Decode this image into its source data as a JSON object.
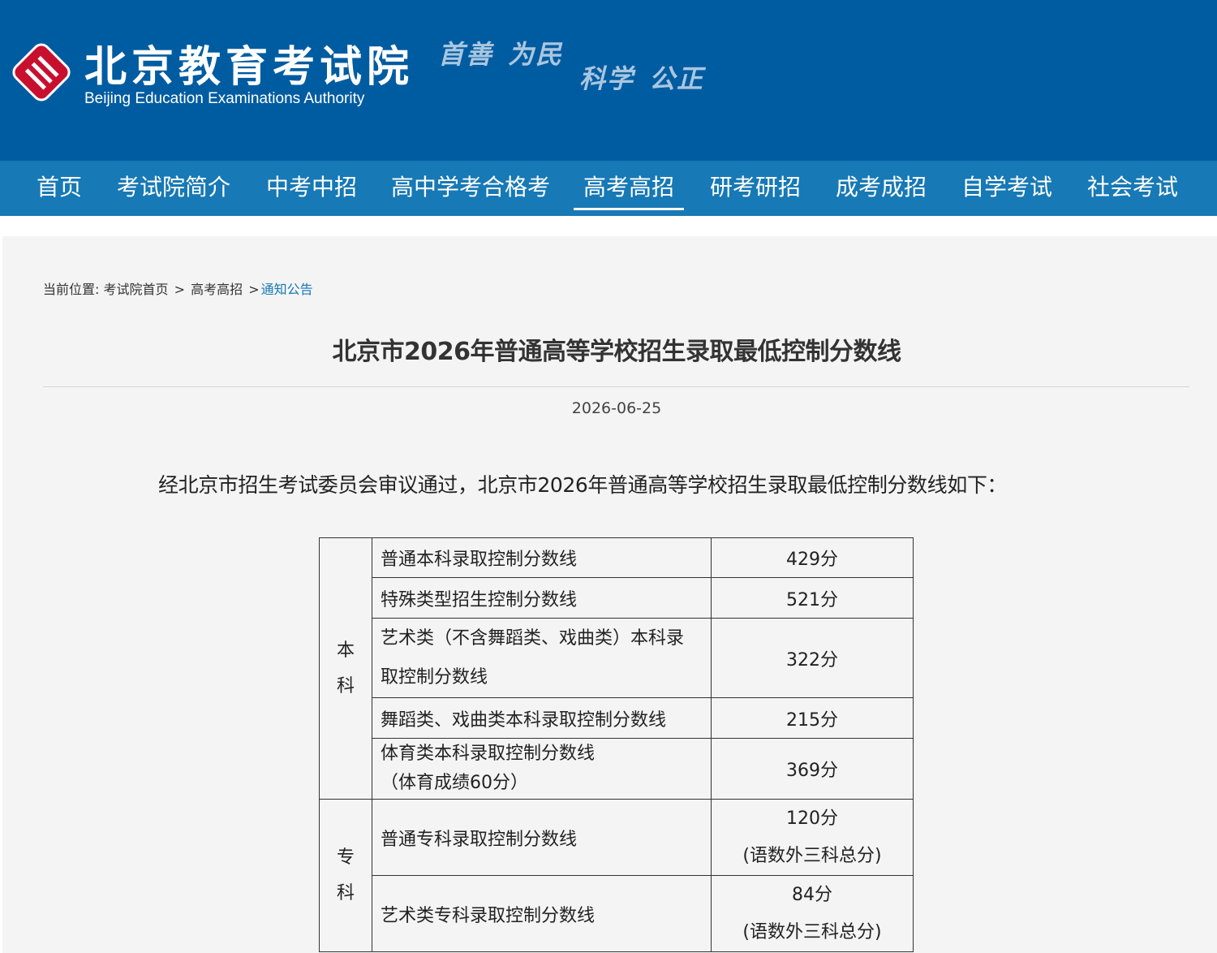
{
  "header": {
    "logo_cn": "北京教育考试院",
    "logo_en": "Beijing Education Examinations Authority",
    "motto": [
      "首善",
      "为民",
      "科学",
      "公正"
    ],
    "brand_color": "#005ca1",
    "emblem_color": "#c8102e"
  },
  "nav": {
    "items": [
      "首页",
      "考试院简介",
      "中考中招",
      "高中学考合格考",
      "高考高招",
      "研考研招",
      "成考成招",
      "自学考试",
      "社会考试"
    ],
    "active": "高考高招",
    "color": "#1779b5"
  },
  "breadcrumb": {
    "prefix": "当前位置:",
    "items": [
      "考试院首页",
      "高考高招",
      "通知公告"
    ],
    "separator": ">"
  },
  "article": {
    "title": "北京市2026年普通高等学校招生录取最低控制分数线",
    "date": "2026-06-25",
    "intro": "经北京市招生考试委员会审议通过，北京市2026年普通高等学校招生录取最低控制分数线如下："
  },
  "table": {
    "groups": [
      {
        "category": [
          "本",
          "科"
        ],
        "rows": [
          {
            "item": [
              "普通本科录取控制分数线"
            ],
            "value": [
              "429分"
            ]
          },
          {
            "item": [
              "特殊类型招生控制分数线"
            ],
            "value": [
              "521分"
            ]
          },
          {
            "item": [
              "艺术类（不含舞蹈类、戏曲类）本科录",
              "取控制分数线"
            ],
            "value": [
              "322分"
            ]
          },
          {
            "item": [
              "舞蹈类、戏曲类本科录取控制分数线"
            ],
            "value": [
              "215分"
            ]
          },
          {
            "item": [
              "体育类本科录取控制分数线",
              "（体育成绩60分）"
            ],
            "value": [
              "369分"
            ]
          }
        ]
      },
      {
        "category": [
          "专",
          "科"
        ],
        "rows": [
          {
            "item": [
              "普通专科录取控制分数线"
            ],
            "value": [
              "120分",
              "(语数外三科总分)"
            ]
          },
          {
            "item": [
              "艺术类专科录取控制分数线"
            ],
            "value": [
              "84分",
              "(语数外三科总分)"
            ]
          }
        ]
      }
    ]
  }
}
